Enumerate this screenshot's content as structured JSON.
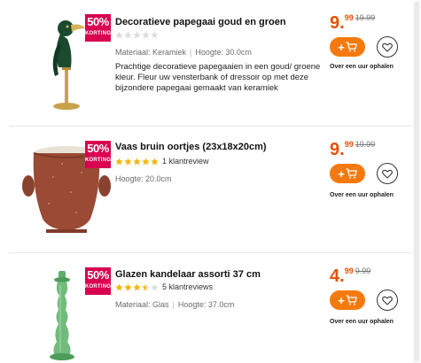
{
  "badge_label": "KORTING",
  "pickup_text": "Over een uur ophalen",
  "colors": {
    "price": "#e35205",
    "cart_button": "#f47a0f",
    "badge": "#d8004f",
    "star_filled": "#f5b400",
    "star_empty": "#dcdcdc"
  },
  "products": [
    {
      "title": "Decoratieve papegaai goud en groen",
      "discount": "50%",
      "rating": 0,
      "review_text": "",
      "meta": [
        "Materiaal: Keramiek",
        "Hoogte: 30.0cm"
      ],
      "description": "Prachtige decoratieve papegaaien in een goud/ groene kleur. Fleur uw vensterbank of dressoir op met deze bijzondere papegaai gemaakt van keramiek",
      "price_int": "9.",
      "price_dec": "99",
      "old_price": "19.99",
      "image_icon": "parrot-figurine-image"
    },
    {
      "title": "Vaas bruin oortjes (23x18x20cm)",
      "discount": "50%",
      "rating": 5,
      "review_text": "1 klantreview",
      "meta": [
        "Hoogte: 20.0cm"
      ],
      "description": "",
      "price_int": "9.",
      "price_dec": "99",
      "old_price": "19.99",
      "image_icon": "brown-vase-image"
    },
    {
      "title": "Glazen kandelaar assorti 37 cm",
      "discount": "50%",
      "rating": 3.5,
      "review_text": "5 klantreviews",
      "meta": [
        "Materiaal: Glas",
        "Hoogte: 37.0cm"
      ],
      "description": "",
      "price_int": "4.",
      "price_dec": "99",
      "old_price": "9.99",
      "image_icon": "glass-candlestick-image"
    }
  ]
}
